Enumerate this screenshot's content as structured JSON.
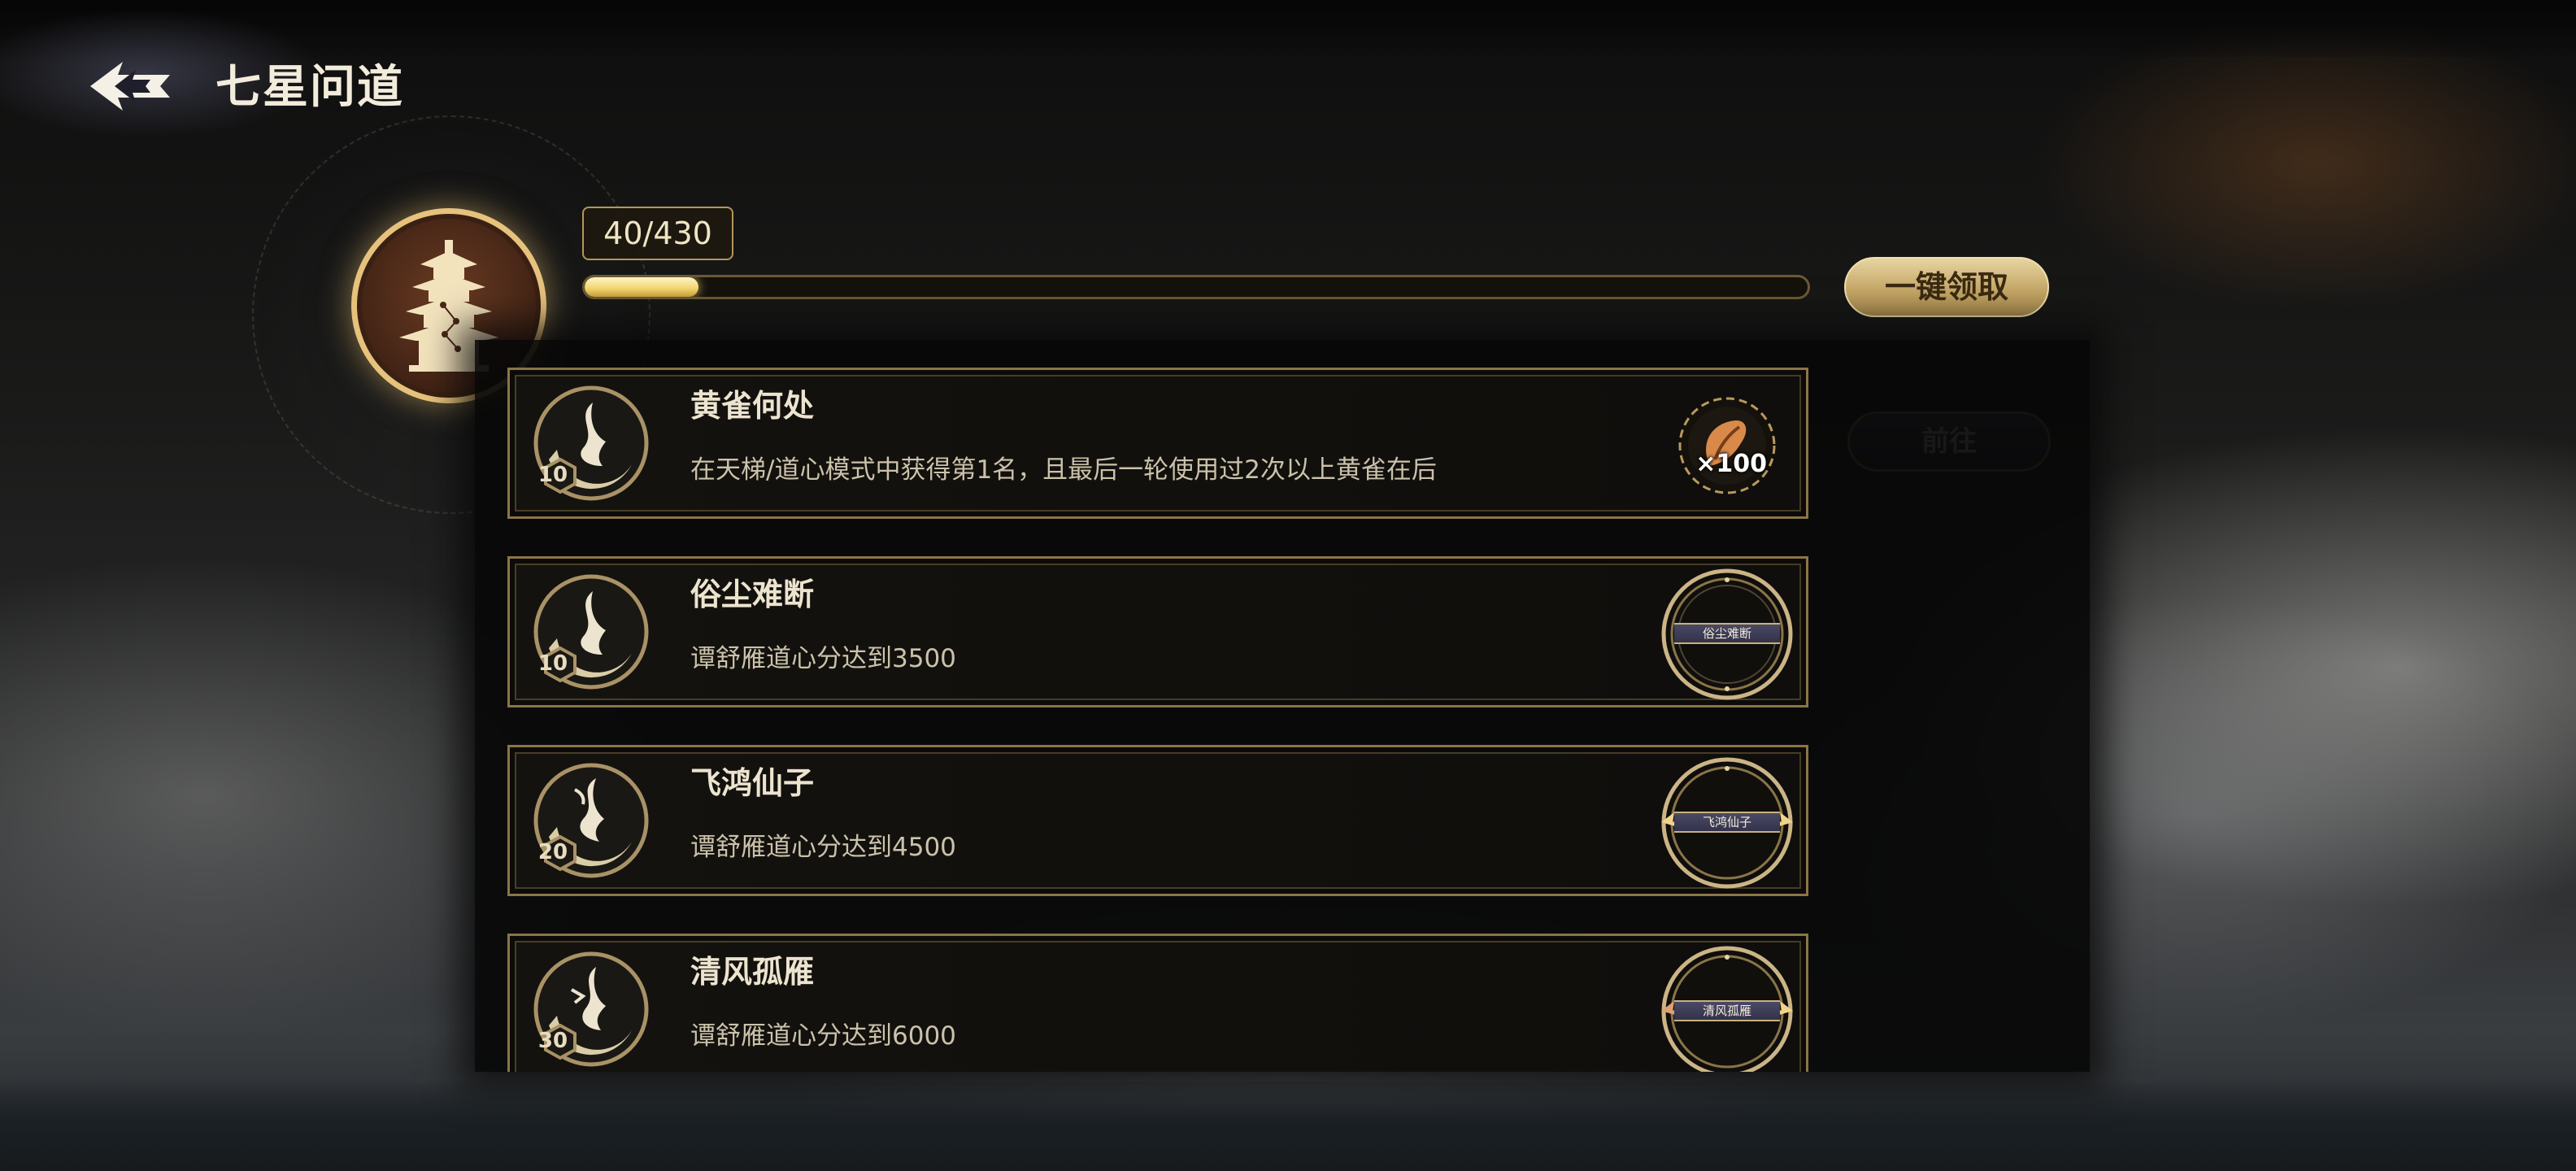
{
  "header": {
    "title": "七星问道",
    "back_icon": "double-arrow-left-icon"
  },
  "progress": {
    "label": "40/430",
    "current": 40,
    "max": 430
  },
  "claim_all_label": "一键领取",
  "goto_label": "前往",
  "emblem_icon": "pagoda-icon",
  "colors": {
    "gold": "#e6c27c",
    "card_border": "#8a7548",
    "progress_fill": "#f3d56b",
    "dark_button": "#34364a"
  },
  "tasks": [
    {
      "title": "黄雀何处",
      "description": "在天梯/道心模式中获得第1名，且最后一轮使用过2次以上黄雀在后",
      "level": "10",
      "reward": {
        "type": "item",
        "icon": "feather-token-icon",
        "quantity": "×100"
      }
    },
    {
      "title": "俗尘难断",
      "description": "谭舒雁道心分达到3500",
      "level": "10",
      "reward": {
        "type": "avatar-frame",
        "icon": "avatar-frame-icon",
        "frame_label": "俗尘难断"
      }
    },
    {
      "title": "飞鸿仙子",
      "description": "谭舒雁道心分达到4500",
      "level": "20",
      "reward": {
        "type": "avatar-frame",
        "icon": "winged-avatar-frame-icon",
        "frame_label": "飞鸿仙子"
      }
    },
    {
      "title": "清风孤雁",
      "description": "谭舒雁道心分达到6000",
      "level": "30",
      "reward": {
        "type": "avatar-frame",
        "icon": "winged-avatar-frame-icon",
        "frame_label": "清风孤雁"
      }
    }
  ]
}
